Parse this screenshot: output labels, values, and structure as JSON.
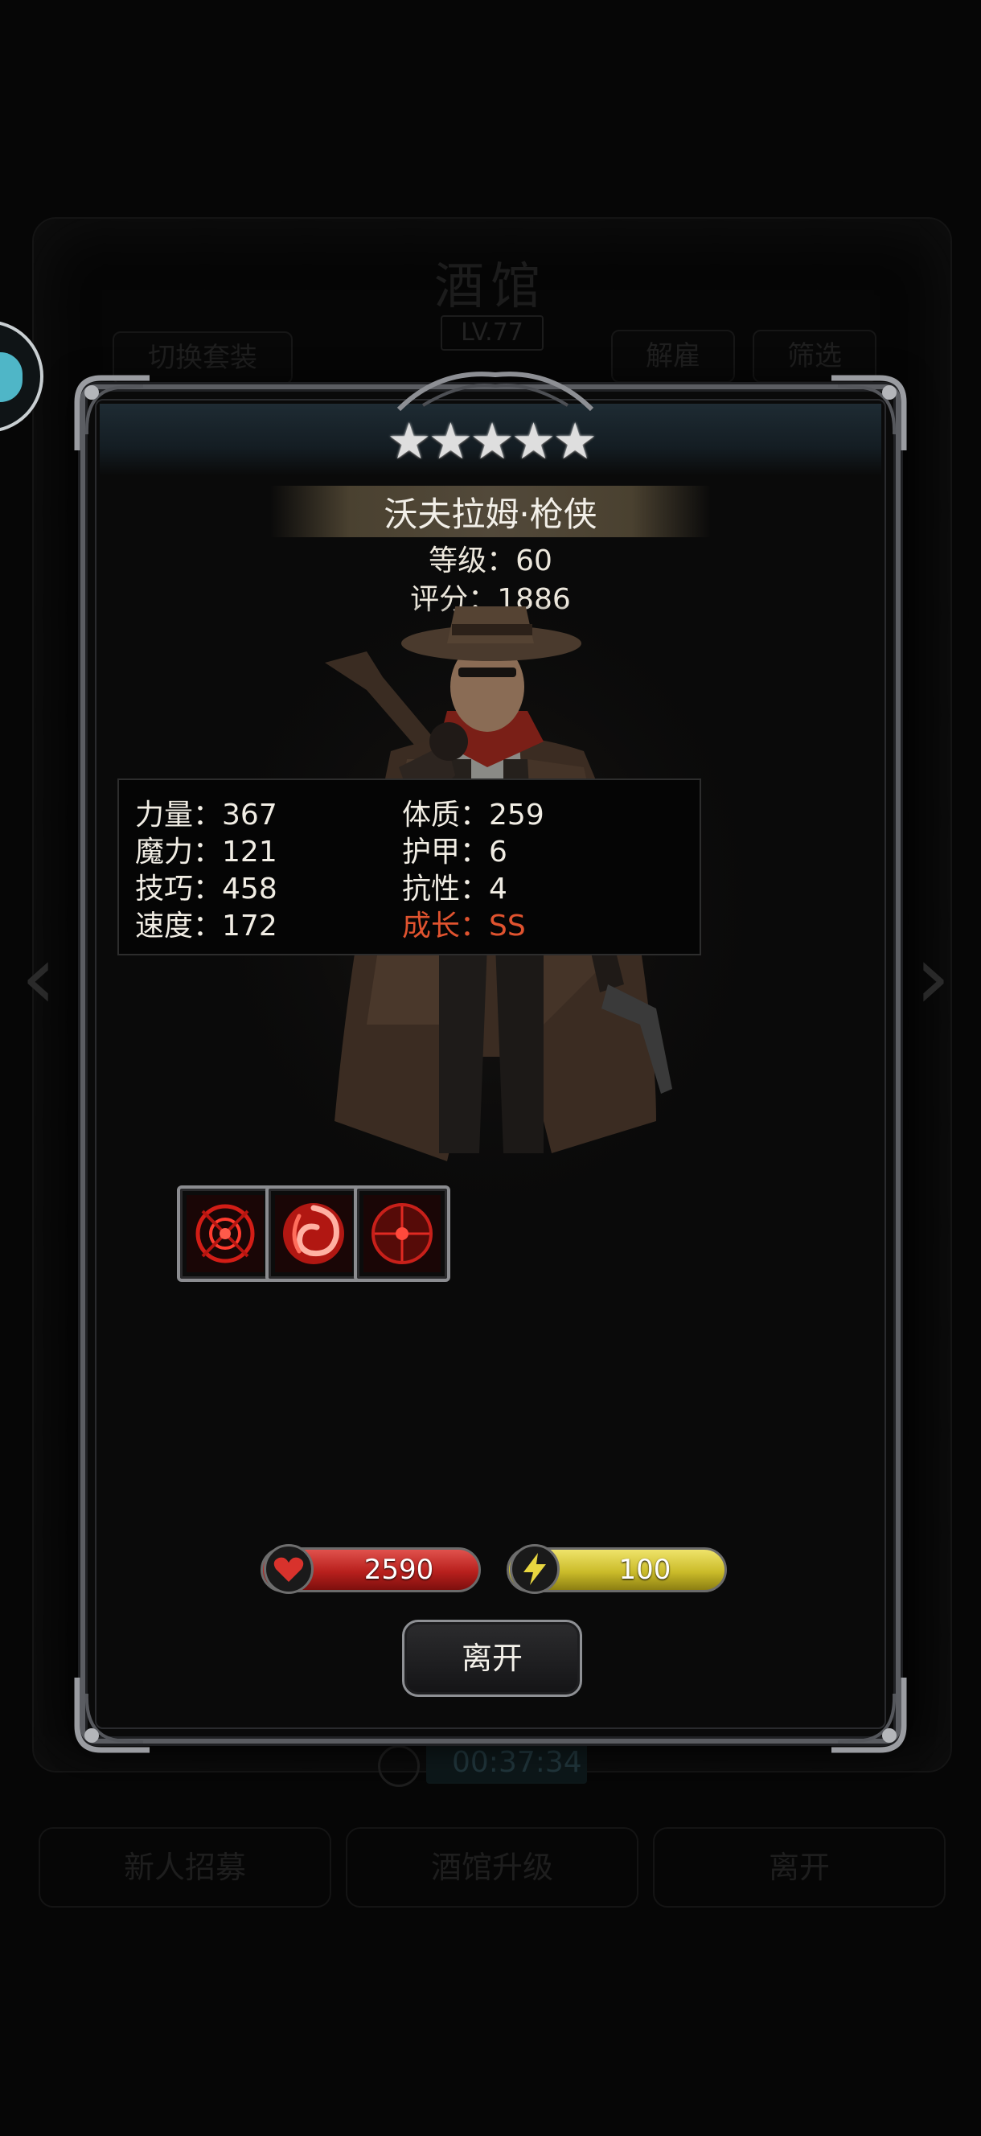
{
  "background": {
    "title": "酒馆",
    "level": "LV.77",
    "switch_outfit": "切换套装",
    "dismiss": "解雇",
    "filter": "筛选",
    "timer": "00:37:34",
    "bottom_buttons": [
      "新人招募",
      "酒馆升级",
      "离开"
    ]
  },
  "hero": {
    "stars": 5,
    "star_glyph": "★",
    "name": "沃夫拉姆·枪侠",
    "level_label": "等级：",
    "level": "60",
    "score_label": "评分：",
    "score": "1886"
  },
  "skills": [
    {
      "icon": "crosshair-burst-icon"
    },
    {
      "icon": "swirl-vortex-icon"
    },
    {
      "icon": "target-scope-icon"
    }
  ],
  "stats": {
    "left": [
      {
        "label": "力量：",
        "value": "367"
      },
      {
        "label": "魔力：",
        "value": "121"
      },
      {
        "label": "技巧：",
        "value": "458"
      },
      {
        "label": "速度：",
        "value": "172"
      }
    ],
    "right": [
      {
        "label": "体质：",
        "value": "259"
      },
      {
        "label": "护甲：",
        "value": "6"
      },
      {
        "label": "抗性：",
        "value": "4"
      },
      {
        "label": "成长：",
        "value": "SS"
      }
    ]
  },
  "bars": {
    "hp": "2590",
    "energy": "100"
  },
  "leave_label": "离开",
  "colors": {
    "growth": "#e0532f",
    "hp_bar": "#c0231f",
    "energy_bar": "#d6c630",
    "name_banner": "#4a4130"
  }
}
